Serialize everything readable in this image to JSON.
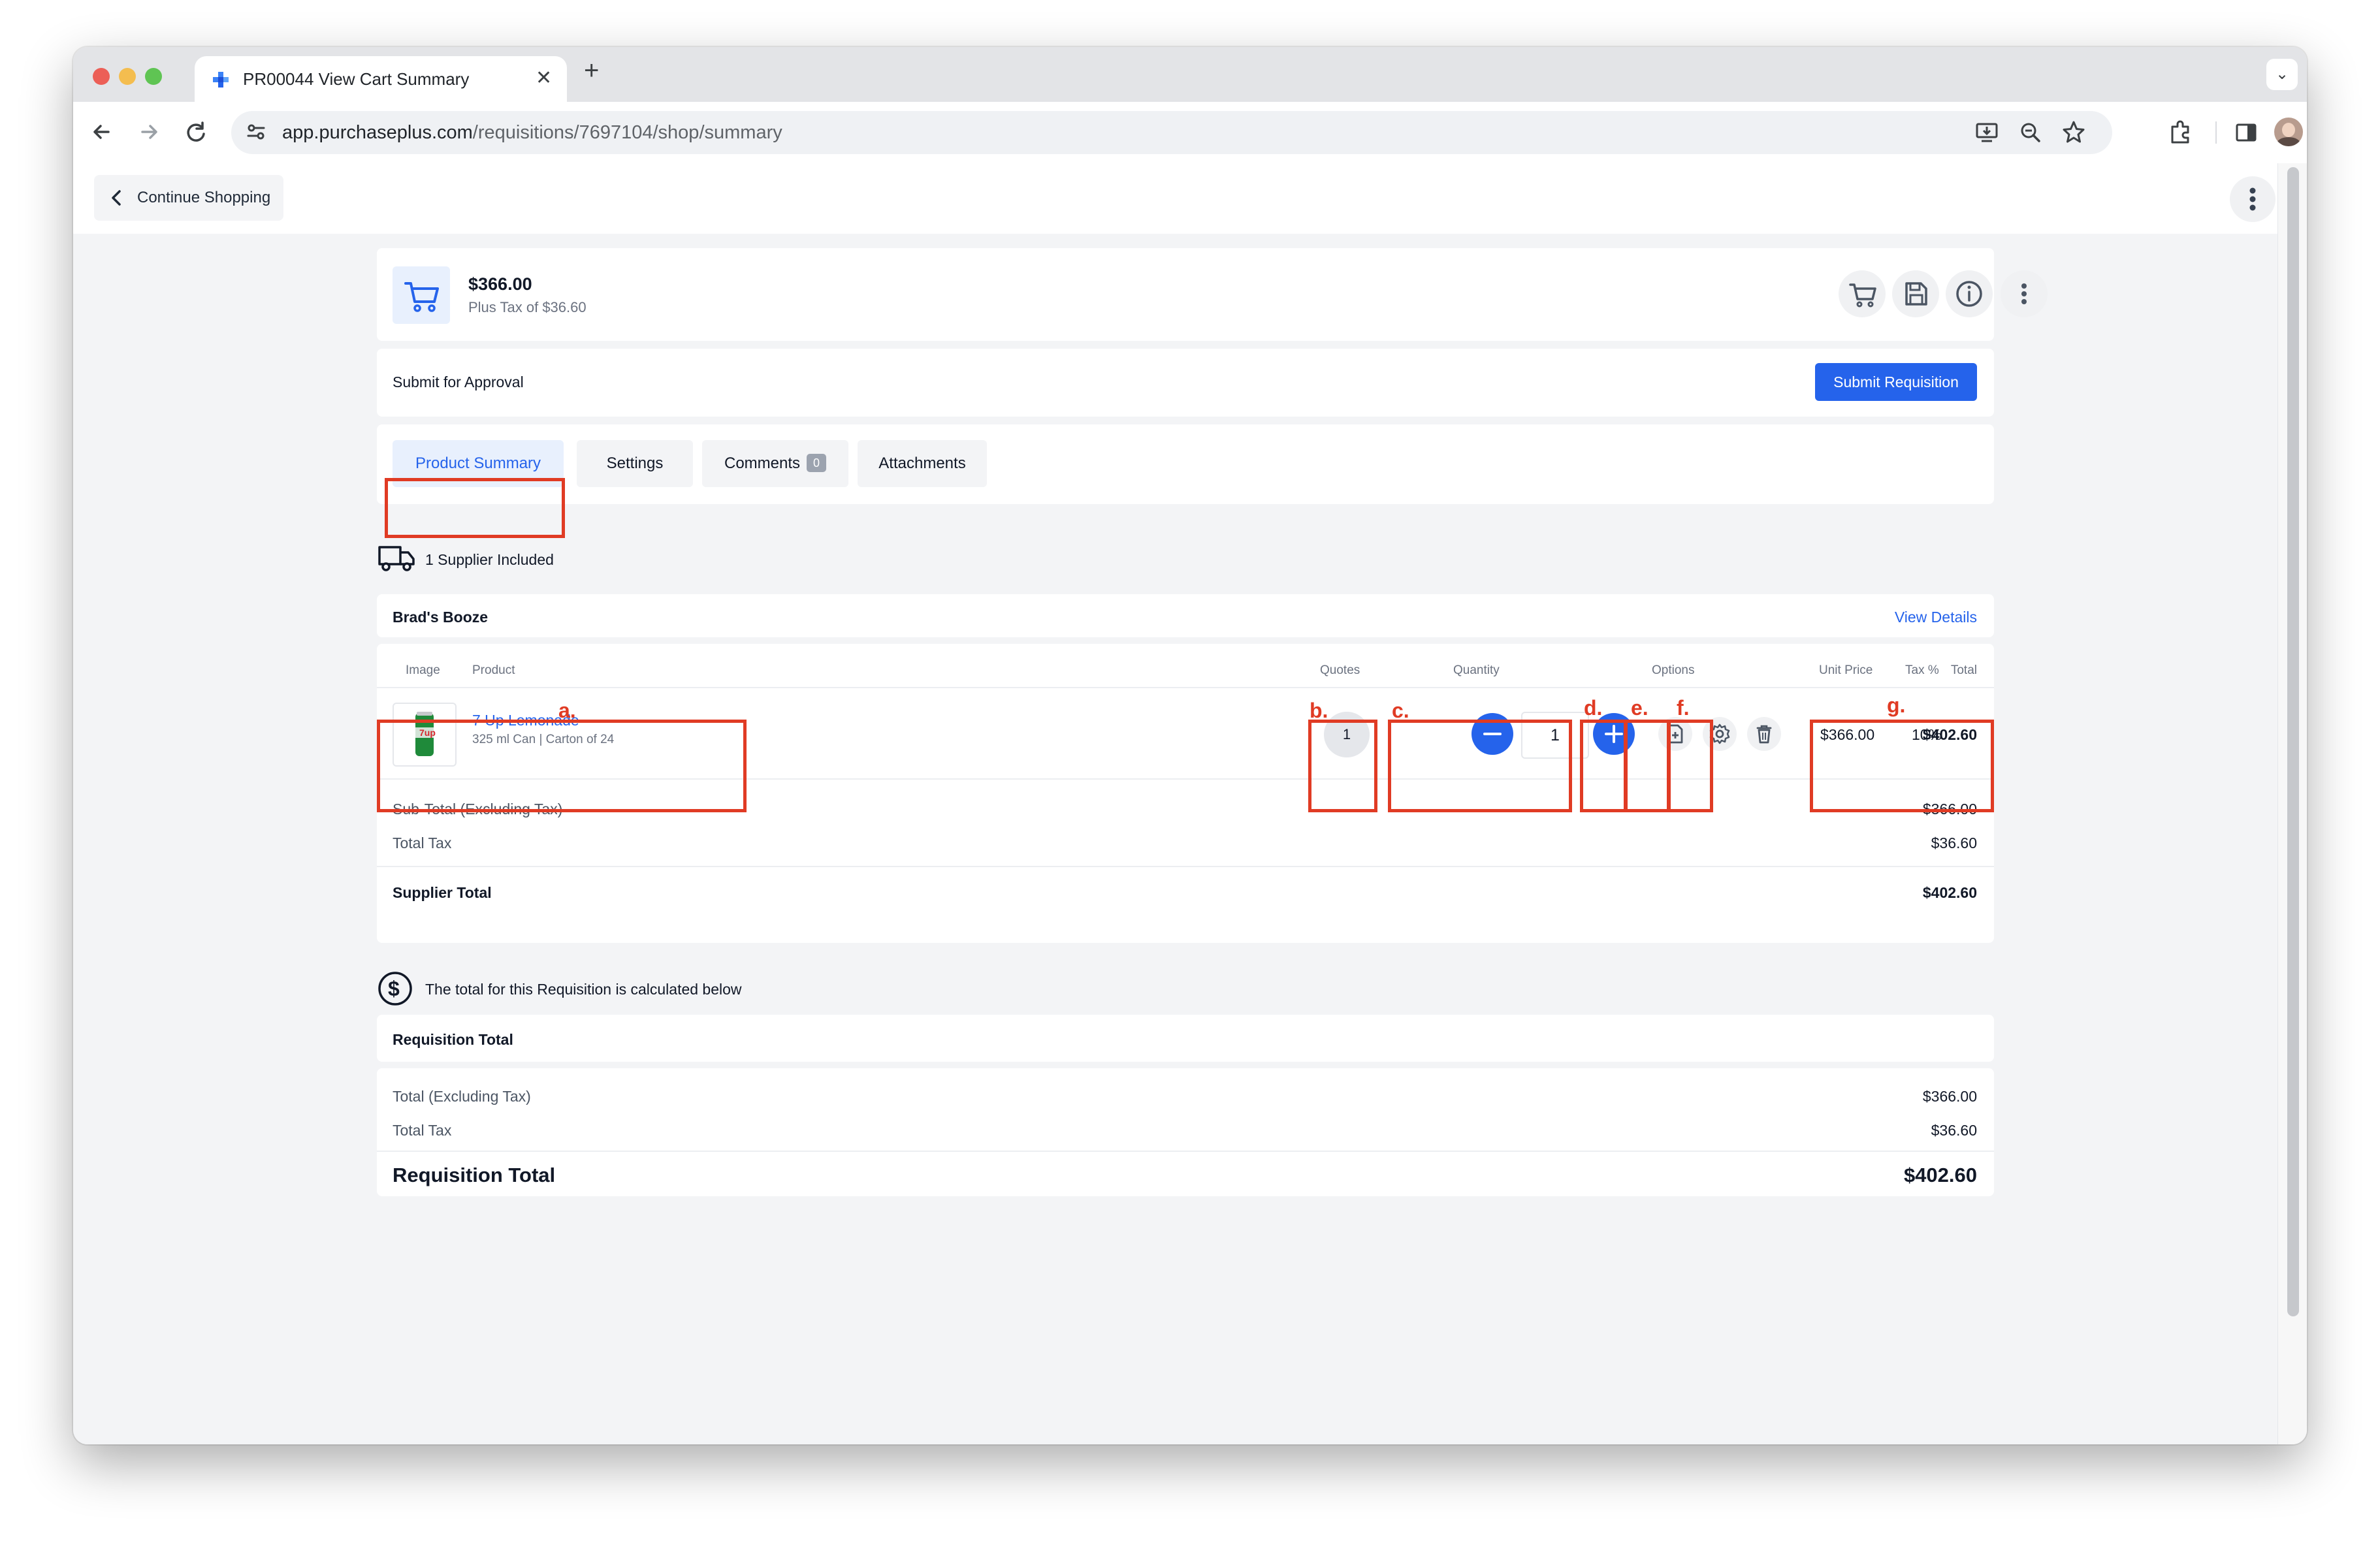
{
  "browser": {
    "tab_title": "PR00044 View Cart Summary",
    "tab_close": "✕",
    "new_tab": "+",
    "tab_menu": "⌄",
    "url_host": "app.purchaseplus.com",
    "url_path": "/requisitions/7697104/shop/summary"
  },
  "topbar": {
    "continue_label": "Continue Shopping"
  },
  "summary": {
    "amount": "$366.00",
    "tax_line": "Plus Tax of $36.60"
  },
  "approval": {
    "label": "Submit for Approval",
    "submit_button": "Submit Requisition"
  },
  "tabs": {
    "product_summary": "Product Summary",
    "settings": "Settings",
    "comments": "Comments",
    "comments_count": "0",
    "attachments": "Attachments"
  },
  "suppliers_included": "1 Supplier Included",
  "supplier": {
    "name": "Brad's Booze",
    "view_details": "View Details",
    "columns": {
      "image": "Image",
      "product": "Product",
      "quotes": "Quotes",
      "quantity": "Quantity",
      "options": "Options",
      "unit_price": "Unit Price",
      "tax": "Tax %",
      "total": "Total"
    },
    "line": {
      "name": "7 Up Lemonade",
      "detail": "325 ml Can | Carton of 24",
      "quotes": "1",
      "quantity": "1",
      "unit_price": "$366.00",
      "tax": "10%",
      "total": "$402.60"
    },
    "subtotal_label": "Sub-Total (Excluding Tax)",
    "subtotal_value": "$366.00",
    "tax_label": "Total Tax",
    "tax_value": "$36.60",
    "total_label": "Supplier Total",
    "total_value": "$402.60"
  },
  "requisition": {
    "note": "The total for this Requisition is calculated below",
    "header": "Requisition Total",
    "excl_label": "Total (Excluding Tax)",
    "excl_value": "$366.00",
    "tax_label": "Total Tax",
    "tax_value": "$36.60",
    "total_label": "Requisition Total",
    "total_value": "$402.60"
  },
  "annotations": {
    "a": "a.",
    "b": "b.",
    "c": "c.",
    "d": "d.",
    "e": "e.",
    "f": "f.",
    "g": "g."
  },
  "icons": {
    "back": "arrow-left-icon",
    "forward": "arrow-right-icon",
    "reload": "reload-icon",
    "cart": "cart-icon",
    "save": "save-icon",
    "info": "info-icon",
    "truck": "truck-icon",
    "dollar": "dollar-circle-icon",
    "add_note": "file-plus-icon",
    "settings": "gear-icon",
    "delete": "trash-icon"
  },
  "colors": {
    "accent": "#2563eb",
    "annotation": "#e03b24",
    "page_bg": "#f3f4f6"
  }
}
